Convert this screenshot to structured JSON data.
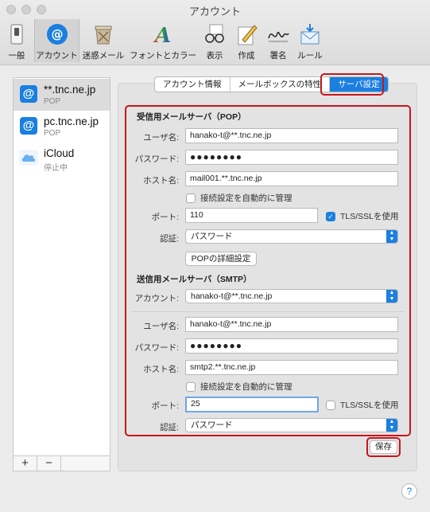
{
  "window": {
    "title": "アカウント"
  },
  "toolbar": [
    {
      "label": "一般",
      "icon": "switch-icon"
    },
    {
      "label": "アカウント",
      "icon": "at-icon"
    },
    {
      "label": "迷惑メール",
      "icon": "junk-bin-icon"
    },
    {
      "label": "フォントとカラー",
      "icon": "font-color-icon"
    },
    {
      "label": "表示",
      "icon": "glasses-icon"
    },
    {
      "label": "作成",
      "icon": "compose-pencil-icon"
    },
    {
      "label": "署名",
      "icon": "signature-icon"
    },
    {
      "label": "ルール",
      "icon": "rules-envelope-icon"
    }
  ],
  "accounts": [
    {
      "name": "**.tnc.ne.jp",
      "status": "POP",
      "icon": "at-icon"
    },
    {
      "name": "pc.tnc.ne.jp",
      "status": "POP",
      "icon": "at-icon"
    },
    {
      "name": "iCloud",
      "status": "停止中",
      "icon": "icloud-icon"
    }
  ],
  "sidebar_footer": {
    "add": "+",
    "remove": "−"
  },
  "tabs": [
    "アカウント情報",
    "メールボックスの特性",
    "サーバ設定"
  ],
  "incoming": {
    "heading": "受信用メールサーバ（POP）",
    "username_label": "ユーザ名:",
    "username": "hanako-t@**.tnc.ne.jp",
    "password_label": "パスワード:",
    "password": "●●●●●●●●",
    "host_label": "ホスト名:",
    "host": "mail001.**.tnc.ne.jp",
    "auto_manage": "接続設定を自動的に管理",
    "port_label": "ポート:",
    "port": "110",
    "tls": "TLS/SSLを使用",
    "auth_label": "認証:",
    "auth": "パスワード",
    "details_button": "POPの詳細設定"
  },
  "outgoing": {
    "heading": "送信用メールサーバ（SMTP）",
    "account_label": "アカウント:",
    "account": "hanako-t@**.tnc.ne.jp",
    "username_label": "ユーザ名:",
    "username": "hanako-t@**.tnc.ne.jp",
    "password_label": "パスワード:",
    "password": "●●●●●●●●",
    "host_label": "ホスト名:",
    "host": "smtp2.**.tnc.ne.jp",
    "auto_manage": "接続設定を自動的に管理",
    "port_label": "ポート:",
    "port": "25",
    "tls": "TLS/SSLを使用",
    "auth_label": "認証:",
    "auth": "パスワード"
  },
  "save_button": "保存",
  "help": "?",
  "colors": {
    "accent": "#1a7fe0",
    "highlight": "#c5161d"
  }
}
